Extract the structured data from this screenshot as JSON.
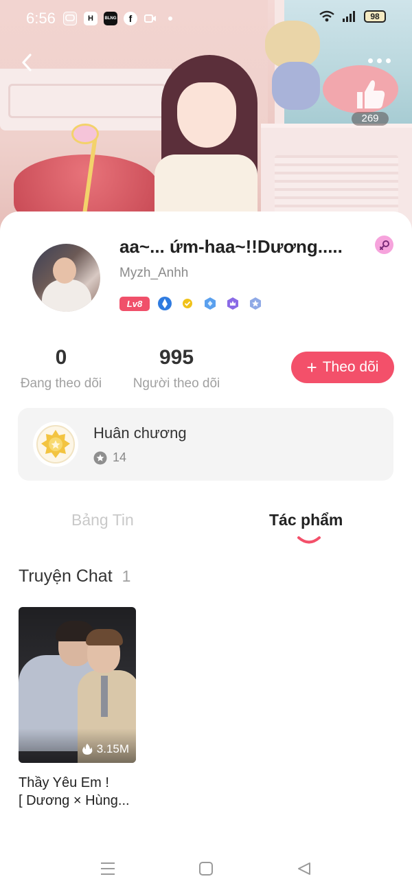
{
  "status_bar": {
    "time": "6:56",
    "battery": "98",
    "apps": [
      "H",
      "BLNG",
      "f"
    ]
  },
  "hero": {
    "like_count": "269"
  },
  "profile": {
    "display_name": "aa~... ứm-haa~!!Dương.....",
    "username": "Myzh_Anhh",
    "level": "Lv8",
    "badge_colors": [
      "#2f7be0",
      "#f0c21a",
      "#5aa0ee",
      "#8a6ae6",
      "#8fa9e6"
    ]
  },
  "stats": {
    "following_count": "0",
    "following_label": "Đang theo dõi",
    "followers_count": "995",
    "followers_label": "Người theo dõi"
  },
  "follow_button": {
    "plus": "+",
    "label": "Theo dõi"
  },
  "medals": {
    "title": "Huân chương",
    "count": "14"
  },
  "tabs": [
    {
      "label": "Bảng Tin",
      "active": false
    },
    {
      "label": "Tác phẩm",
      "active": true
    }
  ],
  "section": {
    "title": "Truyện Chat",
    "count": "1"
  },
  "stories": [
    {
      "views": "3.15M",
      "title_line1": "Thầy Yêu Em !",
      "title_line2": "[ Dương × Hùng..."
    }
  ],
  "colors": {
    "accent": "#f3506a",
    "level_badge": "#f0506a",
    "gender_badge": "#f6a3dc"
  }
}
